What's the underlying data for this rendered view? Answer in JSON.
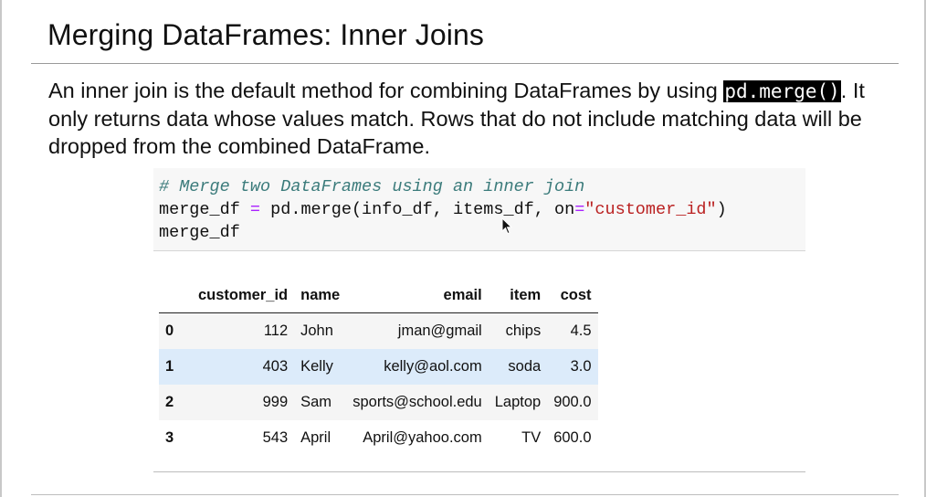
{
  "slide": {
    "title": "Merging DataFrames: Inner Joins",
    "intro": {
      "pre": "An inner join is the default method for combining DataFrames by using ",
      "code": "pd.merge()",
      "post": ". It only returns data whose values match. Rows that do not include matching data will be dropped from the combined DataFrame."
    }
  },
  "code_cell": {
    "comment": "# Merge two DataFrames using an inner join",
    "line2": {
      "var": "merge_df ",
      "op1": "=",
      "call": " pd.merge(info_df, items_df, on",
      "op2": "=",
      "str": "\"customer_id\"",
      "close": ")"
    },
    "line3": "merge_df"
  },
  "table": {
    "columns": [
      "",
      "customer_id",
      "name",
      "email",
      "item",
      "cost"
    ],
    "rows": [
      [
        "0",
        "112",
        "John",
        "jman@gmail",
        "chips",
        "4.5"
      ],
      [
        "1",
        "403",
        "Kelly",
        "kelly@aol.com",
        "soda",
        "3.0"
      ],
      [
        "2",
        "999",
        "Sam",
        "sports@school.edu",
        "Laptop",
        "900.0"
      ],
      [
        "3",
        "543",
        "April",
        "April@yahoo.com",
        "TV",
        "600.0"
      ]
    ]
  },
  "colors": {
    "row_highlight": "#dcebfa",
    "comment": "#3b7b7b",
    "operator": "#aa22ff",
    "string": "#ba2121"
  }
}
